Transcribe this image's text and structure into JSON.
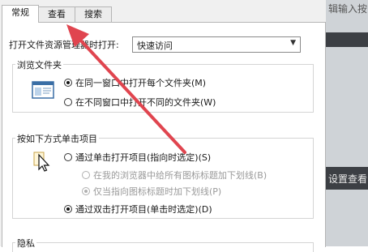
{
  "tabs": [
    {
      "label": "常规",
      "active": true
    },
    {
      "label": "查看",
      "active": false
    },
    {
      "label": "搜索",
      "active": false
    }
  ],
  "open_in": {
    "label": "打开文件资源管理器时打开:",
    "selected": "快速访问"
  },
  "browse_folders": {
    "title": "浏览文件夹",
    "options": [
      {
        "label": "在同一窗口中打开每个文件夹(M)",
        "checked": true,
        "enabled": true
      },
      {
        "label": "在不同窗口中打开不同的文件夹(W)",
        "checked": false,
        "enabled": true
      }
    ]
  },
  "click_items": {
    "title": "按如下方式单击项目",
    "options": [
      {
        "label": "通过单击打开项目(指向时选定)(S)",
        "checked": false,
        "enabled": true
      },
      {
        "label": "在我的浏览器中给所有图标标题加下划线(B)",
        "checked": false,
        "enabled": false
      },
      {
        "label": "仅当指向图标标题时加下划线(P)",
        "checked": true,
        "enabled": false
      },
      {
        "label": "通过双击打开项目(单击时选定)(D)",
        "checked": true,
        "enabled": true
      }
    ]
  },
  "privacy": {
    "title": "隐私"
  },
  "background": {
    "text_top": "辑输入按",
    "text_mid": "设置查看"
  },
  "colors": {
    "annotation_arrow": "#e0454f",
    "accent": "#ffffff"
  }
}
